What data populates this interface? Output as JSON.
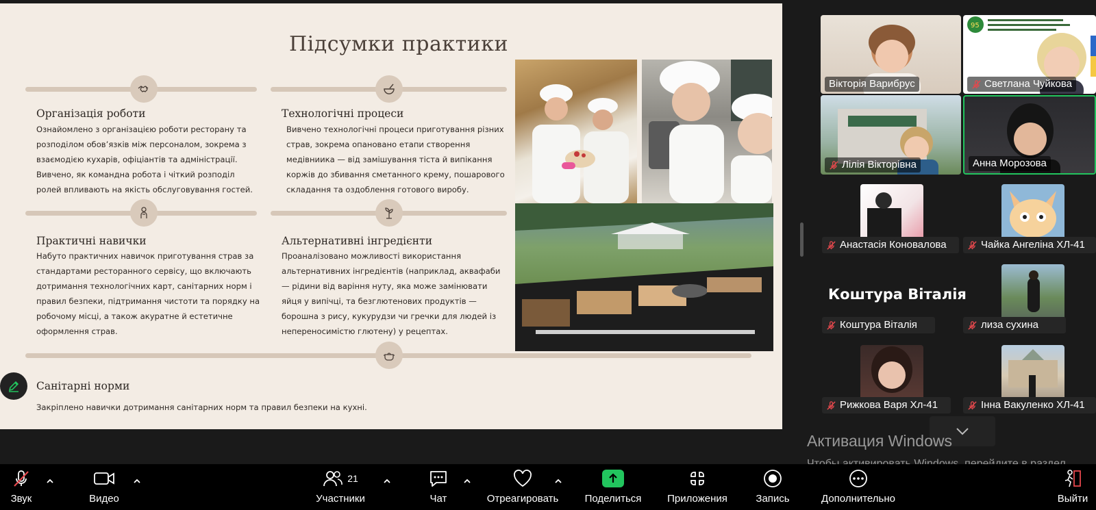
{
  "slide": {
    "title": "Підсумки практики",
    "sections": [
      {
        "heading": "Організація роботи",
        "body": "Ознайомлено з організацією роботи ресторану та розподілом обов’язків між персоналом, зокрема з взаємодією кухарів, офіціантів та адміністрації. Вивчено, як командна робота і чіткий розподіл ролей впливають на якість обслуговування гостей.",
        "icon": "handshake-icon"
      },
      {
        "heading": "Технологічні процеси",
        "body": "Вивчено технологічні процеси приготування різних страв, зокрема опановано етапи створення медівниика — від замішування тіста й випікання коржів до збивання сметанного крему, пошарового складання та оздоблення готового виробу.",
        "icon": "mortar-pestle-icon"
      },
      {
        "heading": "Практичні навички",
        "body": "Набуто практичних навичок приготування страв за стандартами ресторанного сервісу, що включають дотримання технологічних карт, санітарних норм і правил безпеки, підтримання чистоти та порядку на робочому місці, а також акуратне й естетичне оформлення страв.",
        "icon": "chef-icon"
      },
      {
        "heading": "Альтернативні інгредієнти",
        "body": "Проаналізовано можливості використання альтернативних інгредієнтів (наприклад, аквафаби — рідини від варіння нуту, яка може замінювати яйця у випічці, та безглютенових продуктів — борошна з рису, кукурудзи чи гречки для людей із непереносимістю глютену) у рецептах.",
        "icon": "sprout-icon"
      },
      {
        "heading": "Санітарні норми",
        "body": "Закріплено навички дотримання санітарних норм та правил безпеки на кухні.",
        "icon": "pot-icon"
      }
    ]
  },
  "participants": [
    {
      "name": "Вікторія Варибрус",
      "muted": false
    },
    {
      "name": "Светлана Чуйкова",
      "muted": true
    },
    {
      "name": "Лілія Вікторівна",
      "muted": true
    },
    {
      "name": "Анна Морозова",
      "muted": false,
      "active_speaker": true
    },
    {
      "name": "Анастасія Коновалова",
      "muted": true
    },
    {
      "name": "Чайка Ангеліна ХЛ-41",
      "muted": true
    },
    {
      "name": "Коштура Віталія",
      "muted": true
    },
    {
      "name": "лиза сухина",
      "muted": true
    },
    {
      "name": "Рижкова Варя  Хл-41",
      "muted": true
    },
    {
      "name": "Інна Вакуленко ХЛ-41",
      "muted": true
    }
  ],
  "placeholder_name": "Коштура Віталія",
  "school_banner": {
    "badge": "95"
  },
  "windows_activation": {
    "title": "Активация Windows",
    "subtitle": "Чтобы активировать Windows, перейдите в раздел \"Параметры\"."
  },
  "toolbar": {
    "sound": "Звук",
    "video": "Видео",
    "participants": "Участники",
    "participants_count": "21",
    "chat": "Чат",
    "react": "Отреагировать",
    "share": "Поделиться",
    "apps": "Приложения",
    "record": "Запись",
    "more": "Дополнительно",
    "leave": "Выйти"
  },
  "colors": {
    "slide_bg": "#f3ece4",
    "accent_bar": "#d6c7b8",
    "share_green": "#22c55e",
    "mute_red": "#e5484d",
    "active_speaker": "#22c55e"
  }
}
